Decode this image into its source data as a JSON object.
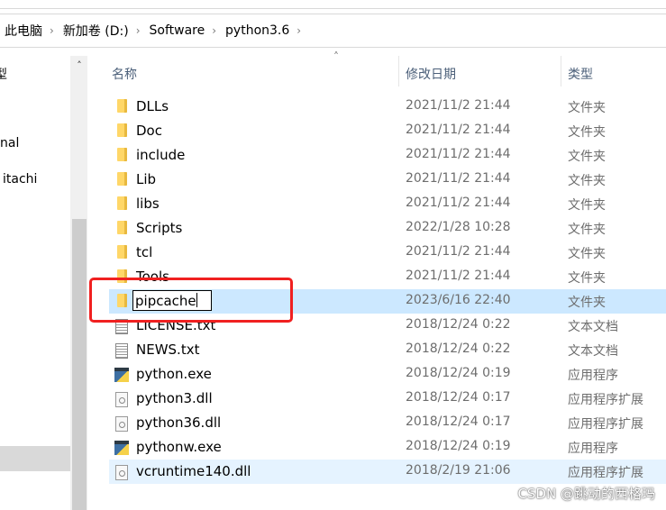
{
  "breadcrumb": [
    "此电脑",
    "新加卷 (D:)",
    "Software",
    "python3.6"
  ],
  "left_pane": {
    "items": [
      "型",
      "nal",
      "itachi"
    ]
  },
  "columns": {
    "name": "名称",
    "date": "修改日期",
    "type": "类型"
  },
  "files": [
    {
      "name": "DLLs",
      "date": "2021/11/2 21:44",
      "type": "文件夹",
      "icon": "folder"
    },
    {
      "name": "Doc",
      "date": "2021/11/2 21:44",
      "type": "文件夹",
      "icon": "folder"
    },
    {
      "name": "include",
      "date": "2021/11/2 21:44",
      "type": "文件夹",
      "icon": "folder"
    },
    {
      "name": "Lib",
      "date": "2021/11/2 21:44",
      "type": "文件夹",
      "icon": "folder"
    },
    {
      "name": "libs",
      "date": "2021/11/2 21:44",
      "type": "文件夹",
      "icon": "folder"
    },
    {
      "name": "Scripts",
      "date": "2022/1/28 10:28",
      "type": "文件夹",
      "icon": "folder"
    },
    {
      "name": "tcl",
      "date": "2021/11/2 21:44",
      "type": "文件夹",
      "icon": "folder"
    },
    {
      "name": "Tools",
      "date": "2021/11/2 21:44",
      "type": "文件夹",
      "icon": "folder"
    },
    {
      "name": "pipcache",
      "date": "2023/6/16 22:40",
      "type": "文件夹",
      "icon": "folder",
      "state": "renaming"
    },
    {
      "name": "LICENSE.txt",
      "date": "2018/12/24 0:22",
      "type": "文本文档",
      "icon": "doc"
    },
    {
      "name": "NEWS.txt",
      "date": "2018/12/24 0:22",
      "type": "文本文档",
      "icon": "doc"
    },
    {
      "name": "python.exe",
      "date": "2018/12/24 0:19",
      "type": "应用程序",
      "icon": "exe"
    },
    {
      "name": "python3.dll",
      "date": "2018/12/24 0:17",
      "type": "应用程序扩展",
      "icon": "dll"
    },
    {
      "name": "python36.dll",
      "date": "2018/12/24 0:17",
      "type": "应用程序扩展",
      "icon": "dll"
    },
    {
      "name": "pythonw.exe",
      "date": "2018/12/24 0:19",
      "type": "应用程序",
      "icon": "exe"
    },
    {
      "name": "vcruntime140.dll",
      "date": "2018/2/19 21:06",
      "type": "应用程序扩展",
      "icon": "dll",
      "state": "hover"
    }
  ],
  "watermark": "CSDN @跳动的西格玛",
  "colors": {
    "selected": "#cce8ff",
    "hover": "#e5f3ff",
    "highlight_box": "#f02020"
  }
}
